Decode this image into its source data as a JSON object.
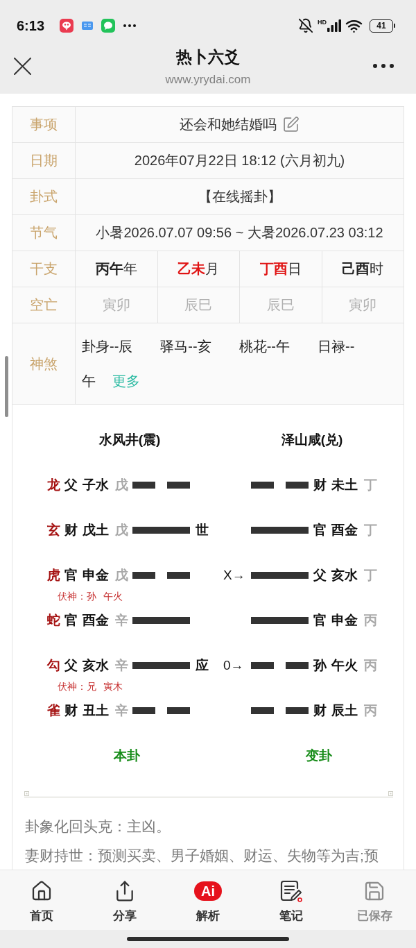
{
  "status_bar": {
    "time": "6:13",
    "network": "HD",
    "battery": "41"
  },
  "header": {
    "title": "热卜六爻",
    "url": "www.yrydai.com"
  },
  "info_table": {
    "rows": [
      {
        "kind": "text",
        "label": "事项",
        "value": "还会和她结婚吗",
        "editable": true
      },
      {
        "kind": "text",
        "label": "日期",
        "value": "2026年07月22日 18:12 (六月初九)",
        "editable": false
      },
      {
        "kind": "text",
        "label": "卦式",
        "value": "【在线摇卦】",
        "editable": false
      },
      {
        "kind": "text",
        "label": "节气",
        "value": "小暑2026.07.07 09:56 ~ 大暑2026.07.23 03:12",
        "editable": false
      },
      {
        "kind": "ganzhi",
        "label": "干支",
        "cells": [
          {
            "stem_branch": "丙午",
            "unit": "年",
            "highlighted": false
          },
          {
            "stem_branch": "乙未",
            "unit": "月",
            "highlighted": true
          },
          {
            "stem_branch": "丁酉",
            "unit": "日",
            "highlighted": true
          },
          {
            "stem_branch": "己酉",
            "unit": "时",
            "highlighted": false
          }
        ]
      },
      {
        "kind": "kongwang",
        "label": "空亡",
        "cells": [
          "寅卯",
          "辰巳",
          "辰巳",
          "寅卯"
        ]
      },
      {
        "kind": "shensha",
        "label": "神煞",
        "items": [
          "卦身--辰",
          "驿马--亥",
          "桃花--午",
          "日禄--午"
        ],
        "more": "更多"
      }
    ]
  },
  "hexagram_chart": {
    "original_name": "水风井(震)",
    "changed_name": "泽山咸(兑)",
    "lines": [
      {
        "spirit": "龙",
        "main": {
          "relative": "父",
          "branch": "子水",
          "stem": "戊",
          "kind": "yin"
        },
        "changed": {
          "relative": "财",
          "branch": "未土",
          "stem": "丁",
          "kind": "yin"
        }
      },
      {
        "spirit": "玄",
        "main": {
          "relative": "财",
          "branch": "戊土",
          "stem": "戊",
          "kind": "yang"
        },
        "role": "世",
        "changed": {
          "relative": "官",
          "branch": "酉金",
          "stem": "丁",
          "kind": "yang"
        }
      },
      {
        "spirit": "虎",
        "main": {
          "relative": "官",
          "branch": "申金",
          "stem": "戊",
          "kind": "yin"
        },
        "move": "X→",
        "changed": {
          "relative": "父",
          "branch": "亥水",
          "stem": "丁",
          "kind": "yang"
        },
        "hidden_spirit": "伏神：孙 午火"
      },
      {
        "spirit": "蛇",
        "main": {
          "relative": "官",
          "branch": "酉金",
          "stem": "辛",
          "kind": "yang"
        },
        "changed": {
          "relative": "官",
          "branch": "申金",
          "stem": "丙",
          "kind": "yang"
        }
      },
      {
        "spirit": "勾",
        "main": {
          "relative": "父",
          "branch": "亥水",
          "stem": "辛",
          "kind": "yang"
        },
        "role": "应",
        "move": "0→",
        "changed": {
          "relative": "孙",
          "branch": "午火",
          "stem": "丙",
          "kind": "yin"
        },
        "hidden_spirit": "伏神：兄 寅木"
      },
      {
        "spirit": "雀",
        "main": {
          "relative": "财",
          "branch": "丑土",
          "stem": "辛",
          "kind": "yin"
        },
        "changed": {
          "relative": "财",
          "branch": "辰土",
          "stem": "丙",
          "kind": "yin"
        }
      }
    ],
    "original_caption": "本卦",
    "changed_caption": "变卦"
  },
  "interpretation": [
    "卦象化回头克：主凶。",
    "妻财持世：预测买卖、男子婚姻、财运、失物等为吉;预"
  ],
  "bottom_nav": [
    {
      "label": "首页",
      "disabled": false
    },
    {
      "label": "分享",
      "disabled": false
    },
    {
      "label": "解析",
      "badge": "Ai",
      "disabled": false
    },
    {
      "label": "笔记",
      "disabled": false
    },
    {
      "label": "已保存",
      "disabled": true
    }
  ]
}
